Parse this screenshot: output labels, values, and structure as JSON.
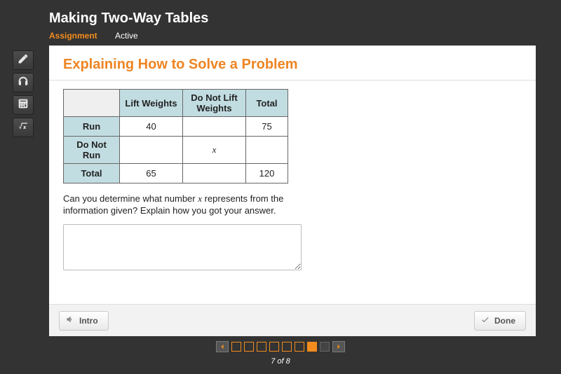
{
  "header": {
    "title": "Making Two-Way Tables",
    "assignment_label": "Assignment",
    "status_label": "Active"
  },
  "slide": {
    "title": "Explaining How to Solve a Problem",
    "prompt_line1": "Can you determine what number ",
    "prompt_var": "x",
    "prompt_line2": " represents from the information given? Explain how you got your answer.",
    "answer_value": ""
  },
  "table": {
    "col_headers": [
      "Lift Weights",
      "Do Not Lift Weights",
      "Total"
    ],
    "rows": [
      {
        "label": "Run",
        "cells": [
          "40",
          "",
          "75"
        ]
      },
      {
        "label": "Do Not Run",
        "cells": [
          "",
          "x",
          ""
        ]
      },
      {
        "label": "Total",
        "cells": [
          "65",
          "",
          "120"
        ]
      }
    ]
  },
  "footer": {
    "intro_label": "Intro",
    "done_label": "Done"
  },
  "pager": {
    "current": 7,
    "total": 8,
    "text": "7 of 8"
  }
}
